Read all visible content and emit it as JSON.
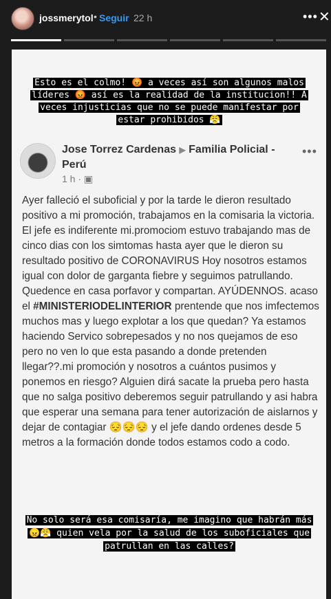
{
  "story": {
    "username": "jossmerytol",
    "separator": "•",
    "follow_label": "Seguir",
    "time": "22 h",
    "more_icon": "•••",
    "close_icon": "✕"
  },
  "overlay_top": "Esto es el colmo! 😡 a veces así son algunos malos líderes 😡 así es la realidad de la institucion!! A veces injusticias que no se puede manifestar por estar prohibidos 😤",
  "post": {
    "author": "Jose Torrez Cardenas",
    "arrow": "▶",
    "group": "Familia Policial - Perú",
    "time": "1 h",
    "privacy_icon": "▣",
    "more_icon": "•••",
    "body_part1": "Ayer falleció el suboficial y por la tarde le dieron resultado positivo a mi promoción, trabajamos en la comisaria la victoria. El jefe es indiferente mi.promociom estuvo trabajando mas de cinco dias con los simtomas hasta ayer que le dieron su resultado positivo de CORONAVIRUS  Hoy nosotros estamos igual con dolor de garganta fiebre y seguimos patrullando. Quedence en casa porfavor y compartan. AYÚDENNOS. acaso el ",
    "hashtag": "#MINISTERIODELINTERIOR",
    "body_part2": " prentende que nos imfectemos muchos mas y luego explotar a los que quedan? Ya estamos haciendo Servico sobrepesados y no nos quejamos de eso pero no ven lo que esta pasando a donde pretenden llegar??.mi promoción y nosotros a cuántos pusimos y ponemos en riesgo? Alguien dirá sacate la prueba pero hasta que no salga positivo deberemos seguir patrullando  y asi habra que esperar una semana para tener autorización de aislarnos y dejar de contagiar 😔😔😔 y el jefe dando ordenes desde 5 metros a la formación donde todos estamos codo a codo."
  },
  "overlay_bottom": "No solo será esa comisaría, me imagino que habrán más 😠😤 quien vela por la salud de los suboficiales que patrullan en las calles?"
}
